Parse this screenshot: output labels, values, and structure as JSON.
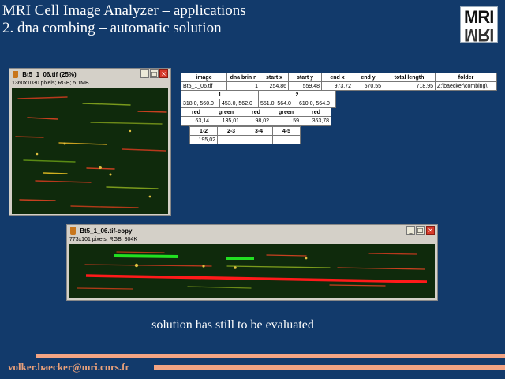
{
  "slide": {
    "title_line1": "MRI Cell Image Analyzer – applications",
    "title_line2": "2. dna combing – automatic solution",
    "logo_text": "MRI",
    "caption": "solution has still to be evaluated",
    "email": "volker.baecker@mri.cnrs.fr",
    "colors": {
      "background": "#123a6b",
      "accent_bars": "#f3a483",
      "email_text": "#e8a07a"
    }
  },
  "window_main": {
    "title": "Bt5_1_06.tif (25%)",
    "info": "1360x1030 pixels; RGB; 5.1MB",
    "buttons": [
      "minimize-icon",
      "maximize-icon",
      "close-icon"
    ]
  },
  "window_copy": {
    "title": "Bt5_1_06.tif-copy",
    "info": "773x101 pixels; RGB; 304K",
    "buttons": [
      "minimize-icon",
      "maximize-icon",
      "close-icon"
    ]
  },
  "results": {
    "headers": [
      "image",
      "dna brin n",
      "start x",
      "start y",
      "end x",
      "end y",
      "total length",
      "folder"
    ],
    "row": [
      "Bt5_1_06.tif",
      "1",
      "254,86",
      "559,48",
      "973,72",
      "570,55",
      "718,95",
      "Z:\\baecker\\combing\\"
    ]
  },
  "points": {
    "headers": [
      "1",
      "2"
    ],
    "values": [
      "318.0, 560.0",
      "453.0, 562.0",
      "551.0, 564.0",
      "610.0, 564.0"
    ]
  },
  "segments": {
    "headers": [
      "red",
      "green",
      "red",
      "green",
      "red"
    ],
    "values": [
      "63,14",
      "135,01",
      "98,02",
      "59",
      "363,78"
    ]
  },
  "gaps": {
    "headers": [
      "1-2",
      "2-3",
      "3-4",
      "4-5"
    ],
    "values": [
      "195,02",
      "",
      "",
      ""
    ]
  }
}
